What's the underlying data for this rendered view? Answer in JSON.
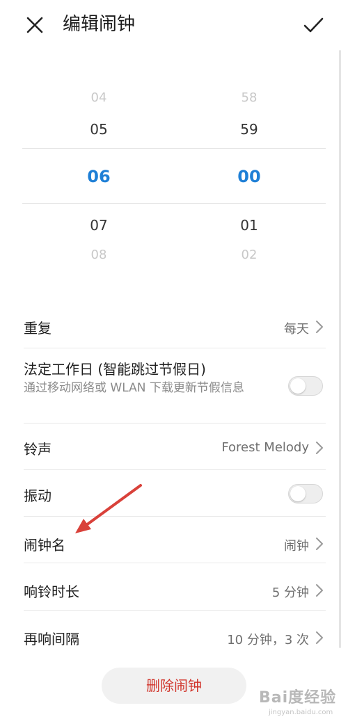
{
  "header": {
    "title": "编辑闹钟",
    "close_icon": "close-icon",
    "confirm_icon": "check-icon"
  },
  "picker": {
    "hours": [
      "04",
      "05",
      "06",
      "07",
      "08"
    ],
    "minutes": [
      "58",
      "59",
      "00",
      "01",
      "02"
    ],
    "selected_hour": "06",
    "selected_minute": "00",
    "selected_color": "#1e7fd6"
  },
  "settings": {
    "repeat": {
      "label": "重复",
      "value": "每天"
    },
    "workday": {
      "label": "法定工作日 (智能跳过节假日)",
      "description": "通过移动网络或 WLAN 下载更新节假信息",
      "enabled": false
    },
    "ringtone": {
      "label": "铃声",
      "value": "Forest Melody"
    },
    "vibration": {
      "label": "振动",
      "enabled": false
    },
    "alarm_name": {
      "label": "闹钟名",
      "value": "闹钟"
    },
    "ring_duration": {
      "label": "响铃时长",
      "value": "5 分钟"
    },
    "snooze": {
      "label": "再响间隔",
      "value": "10 分钟，3 次"
    }
  },
  "delete_button": {
    "label": "删除闹钟",
    "color": "#d1342a"
  },
  "annotation": {
    "arrow_icon": "red-arrow-icon",
    "color": "#d9413a"
  },
  "watermark": {
    "text": "Bai度经验",
    "sub": "jingyan.baidu.com"
  }
}
